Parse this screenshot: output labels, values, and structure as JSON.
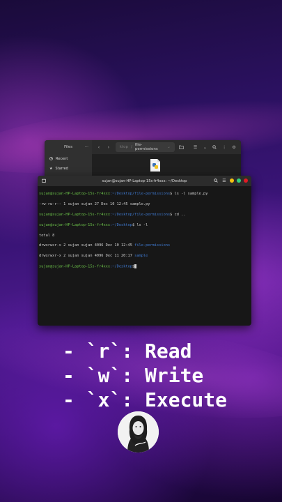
{
  "files_window": {
    "sidebar_title": "Files",
    "sidebar_items": [
      {
        "icon": "clock-icon",
        "label": "Recent"
      },
      {
        "icon": "star-icon",
        "label": "Starred"
      }
    ],
    "breadcrumb": [
      "ktop",
      "file-permissions"
    ]
  },
  "terminal": {
    "title": "sujan@sujan-HP-Laptop-15s-fr4xxx: ~/Desktop",
    "lines": [
      {
        "user": "sujan@sujan-HP-Laptop-15s-fr4xxx",
        "path": ":~/Desktop/file-permissions",
        "cmd": "$ ls -l sample.py"
      },
      {
        "text": "-rw-rw-r-- 1 sujan sujan 27 Dec 10 12:45 sample.py"
      },
      {
        "user": "sujan@sujan-HP-Laptop-15s-fr4xxx",
        "path": ":~/Desktop/file-permissions",
        "cmd": "$ cd .."
      },
      {
        "user": "sujan@sujan-HP-Laptop-15s-fr4xxx",
        "path": ":~/Desktop",
        "cmd": "$ ls -l"
      },
      {
        "text": "total 8"
      },
      {
        "text": "drwxrwxr-x 2 sujan sujan 4096 Dec 10 12:45 ",
        "dir": "file-permissions"
      },
      {
        "text": "drwxrwxr-x 2 sujan sujan 4096 Dec 11 20:17 ",
        "dir": "sample"
      },
      {
        "user": "sujan@sujan-HP-Laptop-15s-fr4xxx",
        "path": ":~/Desktop",
        "cmd": "$"
      }
    ]
  },
  "bullets": [
    "- `r`: Read",
    "- `w`: Write",
    "- `x`: Execute"
  ],
  "avatar": {
    "signature": "Panda"
  },
  "colors": {
    "prompt_user": "#6ac048",
    "prompt_path": "#3f7ad1",
    "dot_yellow": "#f5c211",
    "dot_green": "#33d17a",
    "dot_red": "#e01b24"
  }
}
